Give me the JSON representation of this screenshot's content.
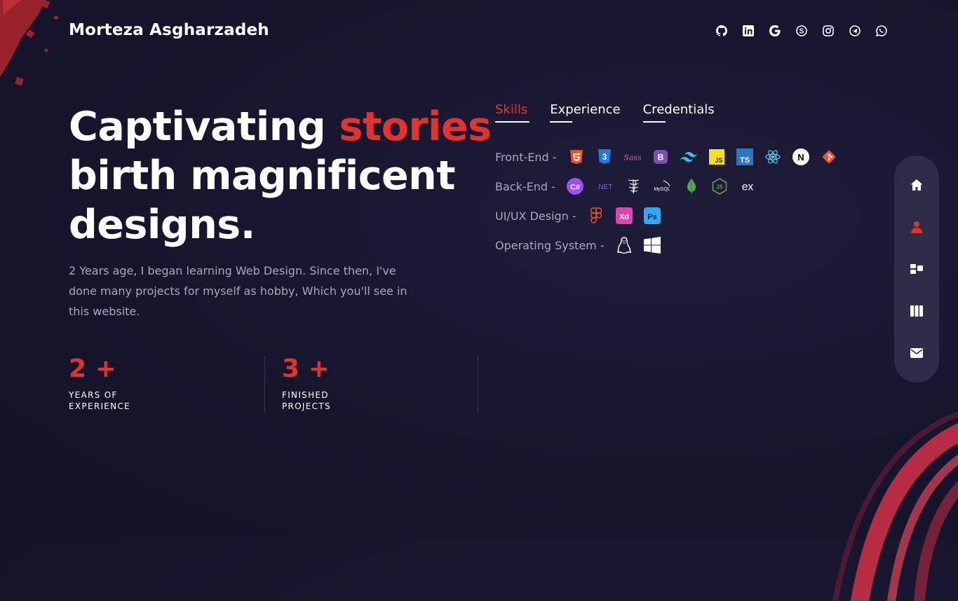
{
  "header": {
    "logo_text": "Morteza Asgharzadeh",
    "social_icons": [
      "github-icon",
      "linkedin-icon",
      "google-icon",
      "skype-icon",
      "instagram-icon",
      "telegram-icon",
      "whatsapp-icon"
    ]
  },
  "hero": {
    "headline_start": "Captivating ",
    "headline_accent": "stories",
    "headline_line2": "birth magnificent",
    "headline_line3": "designs.",
    "intro": "2 Years age, I began learning Web Design. Since then, I've done many projects for myself as hobby, Which you'll see in this website."
  },
  "stats": [
    {
      "value": "2 +",
      "label": "YEARS OF EXPERIENCE"
    },
    {
      "value": "3 +",
      "label": "FINISHED PROJECTS"
    }
  ],
  "tabs": [
    {
      "label": "Skills",
      "active": true
    },
    {
      "label": "Experience",
      "active": false
    },
    {
      "label": "Credentials",
      "active": false
    }
  ],
  "skills": [
    {
      "category": "Front-End -",
      "icons": [
        "html5-icon",
        "css3-icon",
        "sass-icon",
        "bootstrap-icon",
        "tailwind-icon",
        "javascript-icon",
        "typescript-icon",
        "react-icon",
        "nextjs-icon",
        "git-icon"
      ]
    },
    {
      "category": "Back-End -",
      "icons": [
        "csharp-icon",
        "dotnet-icon",
        "sql-server-icon",
        "mysql-icon",
        "mongodb-icon",
        "nodejs-icon",
        "express-icon"
      ]
    },
    {
      "category": "UI/UX Design -",
      "icons": [
        "figma-icon",
        "adobe-xd-icon",
        "photoshop-icon"
      ]
    },
    {
      "category": "Operating System -",
      "icons": [
        "linux-icon",
        "windows-icon"
      ]
    }
  ],
  "icon_text": {
    "css3": "3",
    "bootstrap": "B",
    "javascript": "JS",
    "typescript": "TS",
    "nextjs": "N",
    "csharp": "C#",
    "dotnet": ".NET",
    "mysql": "MySQL",
    "nodejs": "JS",
    "express": "ex",
    "xd": "Xd",
    "ps": "Ps",
    "sass": "Sass"
  },
  "sidenav": {
    "active": "about-nav-icon",
    "items": [
      "home-nav-icon",
      "about-nav-icon",
      "portfolio-nav-icon",
      "services-nav-icon",
      "contact-nav-icon"
    ]
  },
  "colors": {
    "accent": "#e5322d",
    "background": "#18162e",
    "muted_text": "#a9a8bd",
    "sidenav_bg": "#2e2c47"
  }
}
